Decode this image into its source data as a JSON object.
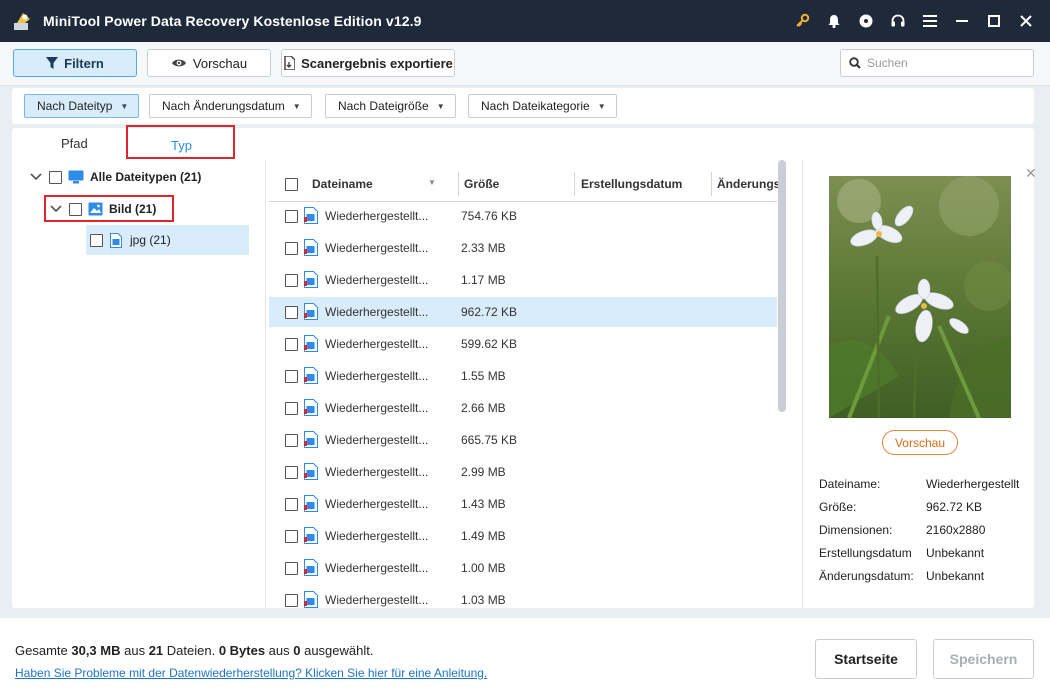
{
  "window": {
    "title": "MiniTool Power Data Recovery Kostenlose Edition v12.9"
  },
  "toolbar": {
    "filter_label": "Filtern",
    "preview_label": "Vorschau",
    "export_label": "Scanergebnis exportiere",
    "search_placeholder": "Suchen"
  },
  "filters": [
    {
      "label": "Nach Dateityp",
      "active": true
    },
    {
      "label": "Nach Änderungsdatum",
      "active": false
    },
    {
      "label": "Nach Dateigröße",
      "active": false
    },
    {
      "label": "Nach Dateikategorie",
      "active": false
    }
  ],
  "tabs": {
    "path": "Pfad",
    "type": "Typ",
    "selected": "type"
  },
  "tree": {
    "root": "Alle Dateitypen (21)",
    "image": "Bild (21)",
    "jpg": "jpg (21)"
  },
  "columns": {
    "name": "Dateiname",
    "size": "Größe",
    "created": "Erstellungsdatum",
    "modified": "Änderungs"
  },
  "files": [
    {
      "name": "Wiederhergestellt...",
      "size": "754.76 KB"
    },
    {
      "name": "Wiederhergestellt...",
      "size": "2.33 MB"
    },
    {
      "name": "Wiederhergestellt...",
      "size": "1.17 MB"
    },
    {
      "name": "Wiederhergestellt...",
      "size": "962.72 KB"
    },
    {
      "name": "Wiederhergestellt...",
      "size": "599.62 KB"
    },
    {
      "name": "Wiederhergestellt...",
      "size": "1.55 MB"
    },
    {
      "name": "Wiederhergestellt...",
      "size": "2.66 MB"
    },
    {
      "name": "Wiederhergestellt...",
      "size": "665.75 KB"
    },
    {
      "name": "Wiederhergestellt...",
      "size": "2.99 MB"
    },
    {
      "name": "Wiederhergestellt...",
      "size": "1.43 MB"
    },
    {
      "name": "Wiederhergestellt...",
      "size": "1.49 MB"
    },
    {
      "name": "Wiederhergestellt...",
      "size": "1.00 MB"
    },
    {
      "name": "Wiederhergestellt...",
      "size": "1.03 MB"
    }
  ],
  "selected_file_index": 3,
  "preview": {
    "button": "Vorschau",
    "labels": {
      "name": "Dateiname:",
      "size": "Größe:",
      "dimensions": "Dimensionen:",
      "created": "Erstellungsdatum",
      "modified": "Änderungsdatum:"
    },
    "values": {
      "name": "Wiederhergestellt",
      "size": "962.72 KB",
      "dimensions": "2160x2880",
      "created": "Unbekannt",
      "modified": "Unbekannt"
    }
  },
  "footer": {
    "summary_1": "Gesamte ",
    "total_size": "30,3 MB",
    "summary_2": " aus ",
    "file_count": "21",
    "summary_3": " Dateien.  ",
    "selected_size": "0 Bytes",
    "summary_4": " aus ",
    "selected_count": "0",
    "summary_5": " ausgewählt.",
    "help_link": "Haben Sie Probleme mit der Datenwiederherstellung? Klicken Sie hier für eine Anleitung.",
    "home_button": "Startseite",
    "save_button": "Speichern"
  },
  "colors": {
    "accent": "#2a8ee0",
    "titlebar": "#1e2a3a",
    "highlight": "#e0242a",
    "key_icon": "#f2b02a"
  }
}
